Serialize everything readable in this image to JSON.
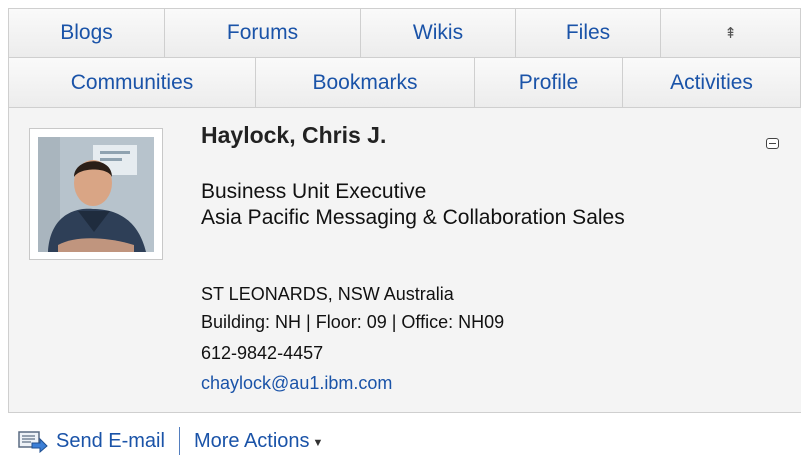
{
  "tabs_row1": [
    "Blogs",
    "Forums",
    "Wikis",
    "Files"
  ],
  "tabs_row2": [
    "Communities",
    "Bookmarks",
    "Profile",
    "Activities"
  ],
  "collapse_icon": "⇞",
  "person": {
    "name": "Haylock, Chris J.",
    "title_line1": "Business Unit Executive",
    "title_line2": "Asia Pacific Messaging & Collaboration Sales",
    "address": "ST LEONARDS, NSW Australia",
    "building": "Building: NH | Floor: 09 | Office: NH09",
    "phone": "612-9842-4457",
    "email": "chaylock@au1.ibm.com"
  },
  "footer": {
    "send_label": "Send E-mail",
    "more_label": "More Actions"
  },
  "colors": {
    "link": "#1a53a8",
    "panel": "#f4f4f4",
    "border": "#cfcfcf"
  },
  "icons": {
    "collapse": "collapse-tabs-icon",
    "minimize": "minimize-icon",
    "mail": "mail-icon",
    "caret": "caret-down-icon"
  }
}
